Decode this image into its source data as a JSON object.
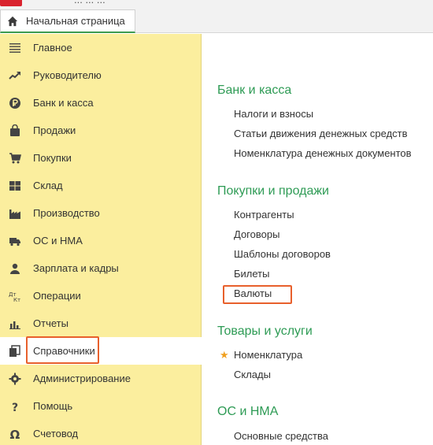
{
  "top_strip": {
    "title_fragment": "... ...   ..."
  },
  "home_tab": {
    "label": "Начальная страница",
    "icon": "home-icon"
  },
  "sidebar": {
    "items": [
      {
        "name": "glavnoe",
        "label": "Главное",
        "icon": "menu-lines-icon"
      },
      {
        "name": "rukovoditelyu",
        "label": "Руководителю",
        "icon": "trend-up-icon"
      },
      {
        "name": "bank-kassa",
        "label": "Банк и касса",
        "icon": "ruble-coin-icon"
      },
      {
        "name": "prodazhi",
        "label": "Продажи",
        "icon": "shopping-bag-icon"
      },
      {
        "name": "pokupki",
        "label": "Покупки",
        "icon": "cart-icon"
      },
      {
        "name": "sklad",
        "label": "Склад",
        "icon": "warehouse-grid-icon"
      },
      {
        "name": "proizvodstvo",
        "label": "Производство",
        "icon": "factory-icon"
      },
      {
        "name": "os-nma",
        "label": "ОС и НМА",
        "icon": "truck-icon"
      },
      {
        "name": "zarplata",
        "label": "Зарплата и кадры",
        "icon": "person-icon"
      },
      {
        "name": "operacii",
        "label": "Операции",
        "icon": "debit-credit-icon"
      },
      {
        "name": "otchety",
        "label": "Отчеты",
        "icon": "bar-chart-icon"
      },
      {
        "name": "spravochniki",
        "label": "Справочники",
        "icon": "books-icon",
        "active": true
      },
      {
        "name": "administrirovanie",
        "label": "Администрирование",
        "icon": "gear-icon"
      },
      {
        "name": "pomosch",
        "label": "Помощь",
        "icon": "question-icon"
      },
      {
        "name": "schetovod",
        "label": "Счетовод",
        "icon": "omega-icon"
      }
    ]
  },
  "content": {
    "sections": [
      {
        "title": "Банк и касса",
        "links": [
          "Налоги и взносы",
          "Статьи движения денежных средств",
          "Номенклатура денежных документов"
        ]
      },
      {
        "title": "Покупки и продажи",
        "links": [
          "Контрагенты",
          "Договоры",
          "Шаблоны договоров",
          "Билеты",
          "Валюты"
        ]
      },
      {
        "title": "Товары и услуги",
        "links": [
          "Номенклатура",
          "Склады"
        ]
      },
      {
        "title": "ОС и НМА",
        "links": [
          "Основные средства"
        ]
      }
    ]
  },
  "colors": {
    "sidebar_bg": "#fbee9e",
    "section_title": "#2e9b55",
    "highlight_box": "#e8602c",
    "favorite_star": "#f0a020"
  }
}
